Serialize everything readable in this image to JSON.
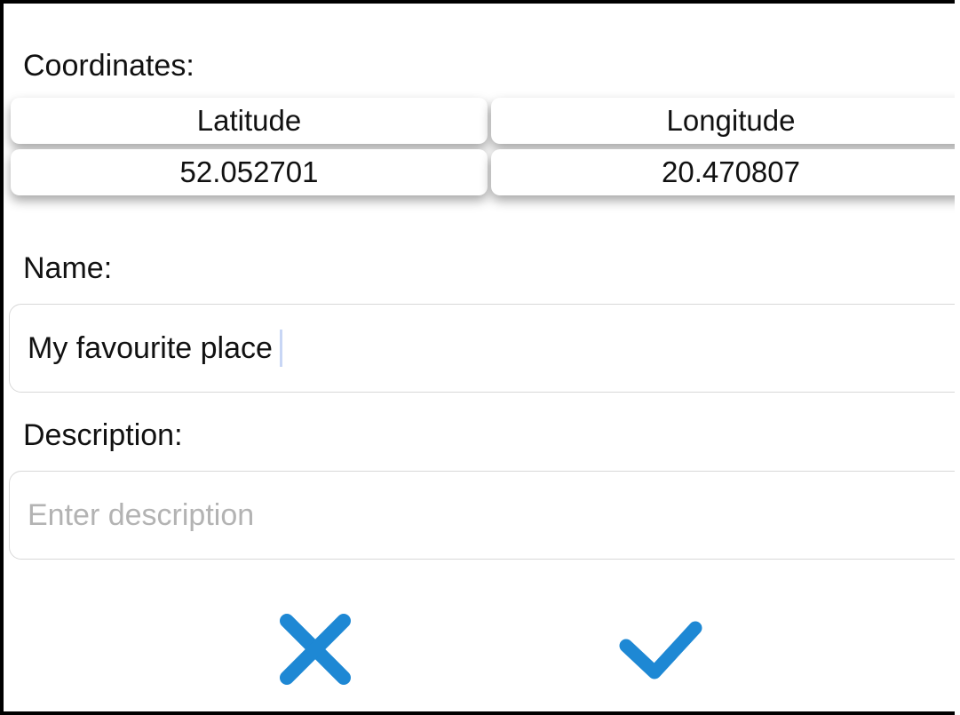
{
  "coordinates": {
    "label": "Coordinates:",
    "headers": {
      "latitude": "Latitude",
      "longitude": "Longitude"
    },
    "values": {
      "latitude": "52.052701",
      "longitude": "20.470807"
    }
  },
  "name": {
    "label": "Name:",
    "value": "My favourite place"
  },
  "description": {
    "label": "Description:",
    "placeholder": "Enter description",
    "value": ""
  },
  "actions": {
    "cancel_icon": "close-icon",
    "confirm_icon": "check-icon",
    "accent_color": "#1e88d4"
  }
}
